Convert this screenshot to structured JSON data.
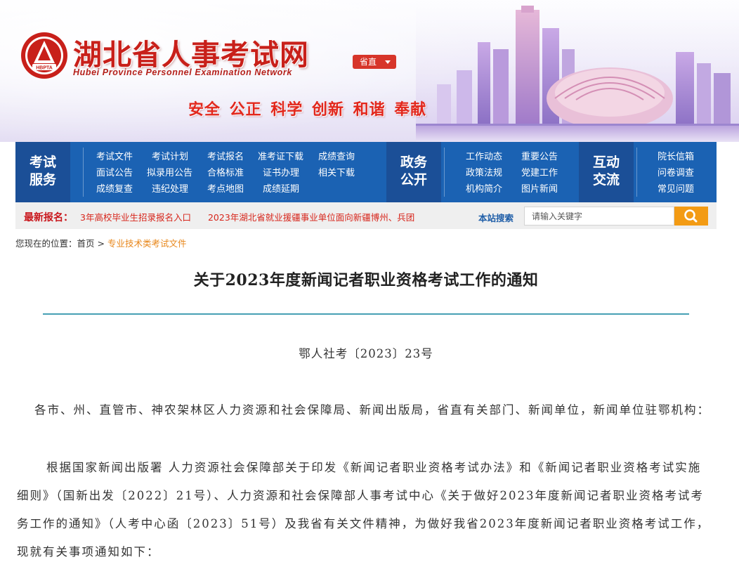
{
  "header": {
    "site_title": "湖北省人事考试网",
    "site_subtitle": "Hubei Province Personnel Examination Network",
    "emblem_text": "HBPTA",
    "region_selector": "省直",
    "slogan": "安全 公正 科学 创新 和谐 奉献"
  },
  "nav": {
    "exam_service": {
      "heading_line1": "考试",
      "heading_line2": "服务",
      "rows": [
        [
          "考试文件",
          "考试计划",
          "考试报名",
          "准考证下载",
          "成绩查询"
        ],
        [
          "面试公告",
          "拟录用公告",
          "合格标准",
          "证书办理",
          "相关下载"
        ],
        [
          "成绩复查",
          "违纪处理",
          "考点地图",
          "成绩延期"
        ]
      ]
    },
    "government_affairs": {
      "heading_line1": "政务",
      "heading_line2": "公开",
      "rows": [
        [
          "工作动态",
          "重要公告"
        ],
        [
          "政策法规",
          "党建工作"
        ],
        [
          "机构简介",
          "图片新闻"
        ]
      ]
    },
    "interaction": {
      "heading_line1": "互动",
      "heading_line2": "交流",
      "rows": [
        [
          "院长信箱"
        ],
        [
          "问卷调查"
        ],
        [
          "常见问题"
        ]
      ]
    }
  },
  "ticker": {
    "label": "最新报名：",
    "items": [
      "3年高校毕业生招录报名入口",
      "2023年湖北省就业援疆事业单位面向新疆博州、兵团"
    ]
  },
  "search": {
    "label": "本站搜索",
    "placeholder": "请输入关键字",
    "button_icon": "search-icon"
  },
  "breadcrumb": {
    "prefix": "您现在的位置：",
    "home": "首页",
    "separator": ">",
    "current": "专业技术类考试文件"
  },
  "article": {
    "title": "关于2023年度新闻记者职业资格考试工作的通知",
    "doc_number": "鄂人社考〔2023〕23号",
    "paragraphs": [
      "各市、州、直管市、神农架林区人力资源和社会保障局、新闻出版局，省直有关部门、新闻单位，新闻单位驻鄂机构：",
      "根据国家新闻出版署 人力资源社会保障部关于印发《新闻记者职业资格考试办法》和《新闻记者职业资格考试实施细则》（国新出发〔2022〕21号）、人力资源和社会保障部人事考试中心《关于做好2023年度新闻记者职业资格考试考务工作的通知》（人考中心函〔2023〕51号）及我省有关文件精神，为做好我省2023年度新闻记者职业资格考试工作，现就有关事项通知如下："
    ]
  },
  "colors": {
    "brand_red": "#c8201a",
    "nav_blue": "#1b62b3",
    "nav_head_blue": "#1b4f97",
    "search_orange": "#f39b14",
    "rule_teal": "#46a0b4"
  }
}
